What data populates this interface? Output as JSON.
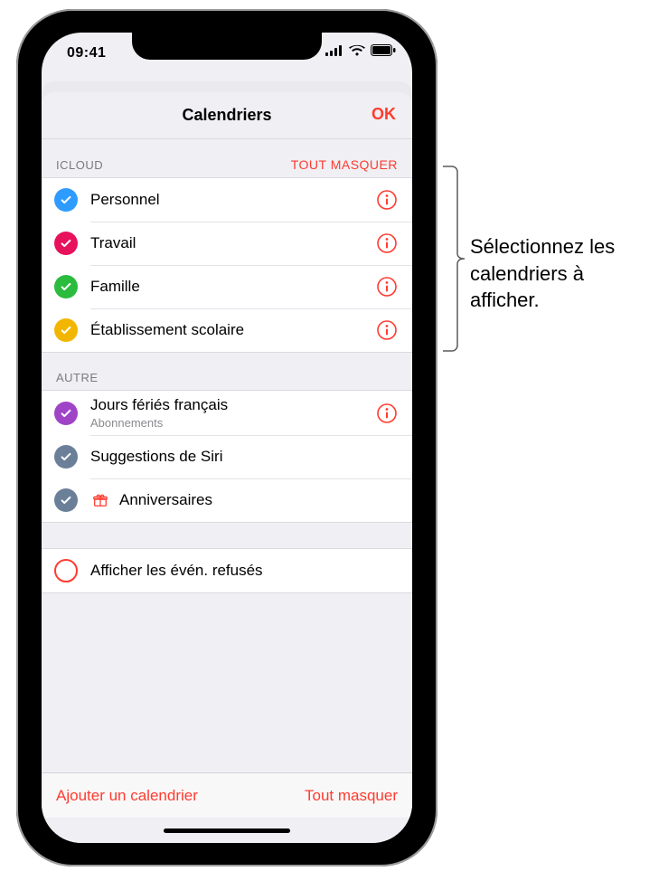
{
  "status": {
    "time": "09:41"
  },
  "sheet": {
    "title": "Calendriers",
    "done": "OK"
  },
  "sections": {
    "icloud": {
      "header": "ICLOUD",
      "action": "TOUT MASQUER",
      "items": [
        {
          "label": "Personnel",
          "color": "#2e9cff",
          "checked": true,
          "info": true
        },
        {
          "label": "Travail",
          "color": "#e7125b",
          "checked": true,
          "info": true
        },
        {
          "label": "Famille",
          "color": "#2bbb3e",
          "checked": true,
          "info": true
        },
        {
          "label": "Établissement scolaire",
          "color": "#f3b600",
          "checked": true,
          "info": true
        }
      ]
    },
    "autre": {
      "header": "AUTRE",
      "items": [
        {
          "label": "Jours fériés français",
          "sub": "Abonnements",
          "color": "#a044c7",
          "checked": true,
          "info": true
        },
        {
          "label": "Suggestions de Siri",
          "color": "#6b7f99",
          "checked": true,
          "info": false
        },
        {
          "label": "Anniversaires",
          "color": "#6b7f99",
          "checked": true,
          "info": false,
          "gift": true
        }
      ]
    },
    "declined": {
      "label": "Afficher les évén. refusés",
      "color": "#ff3b30",
      "checked": false
    }
  },
  "toolbar": {
    "add": "Ajouter un calendrier",
    "hide_all": "Tout masquer"
  },
  "callout": "Sélectionnez les calendriers à afficher."
}
